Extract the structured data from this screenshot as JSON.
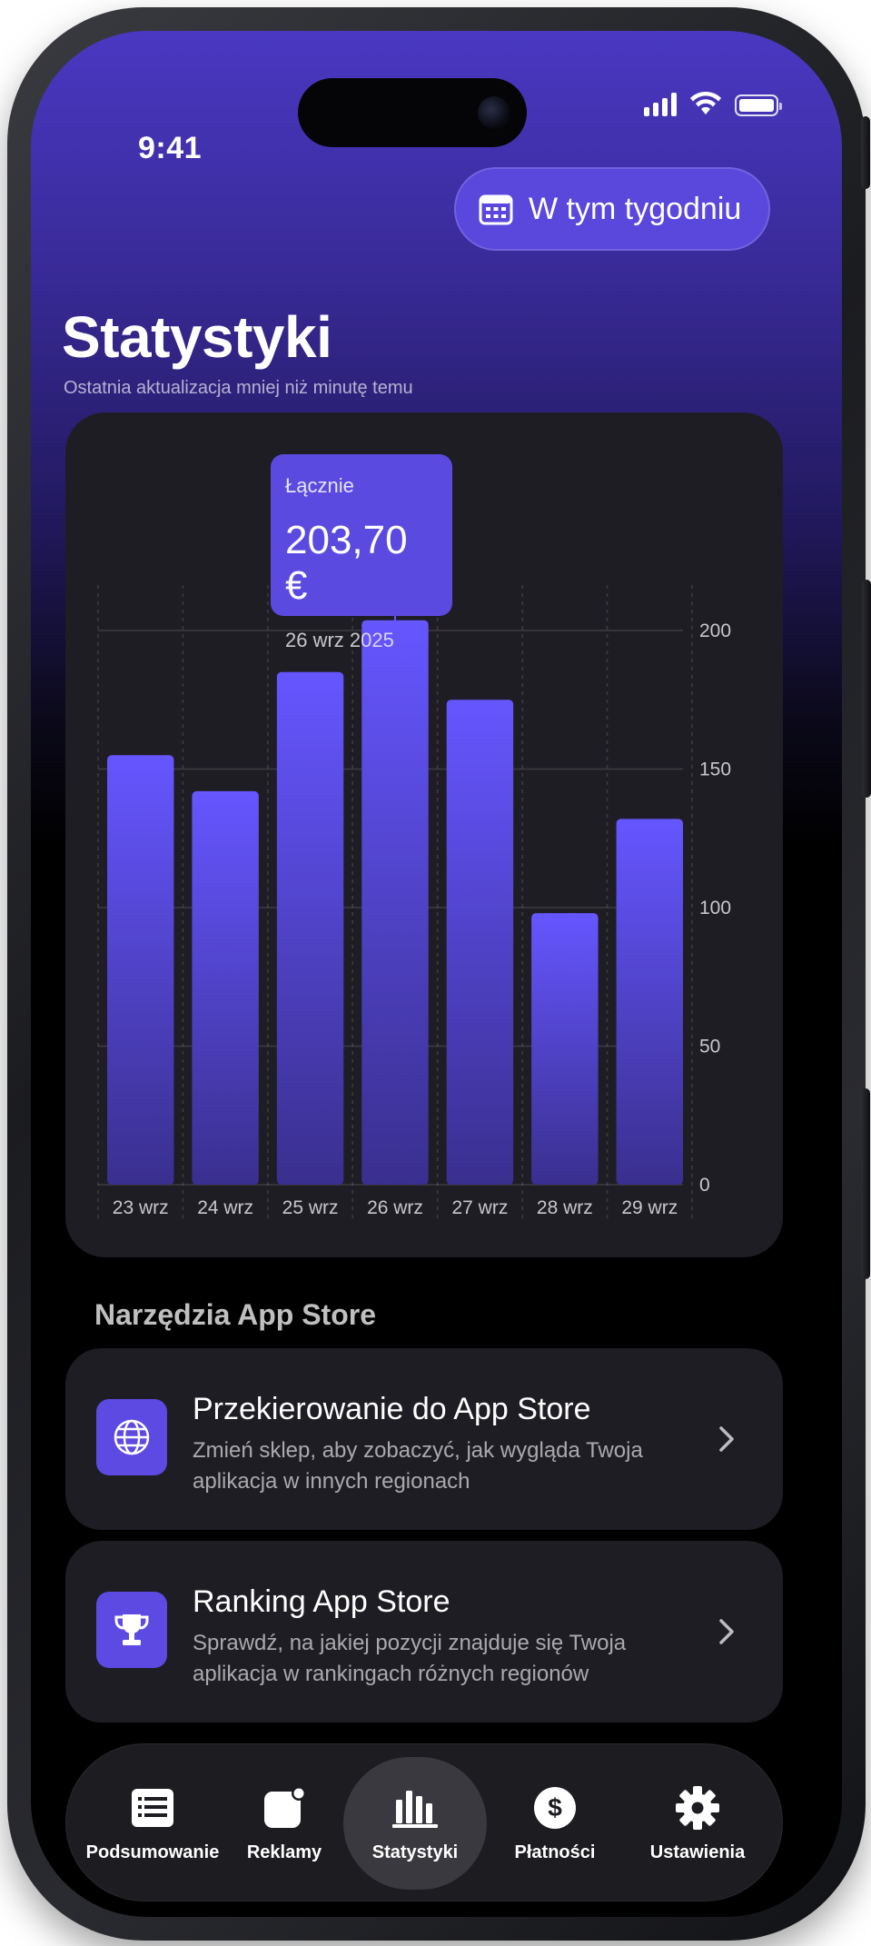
{
  "status_bar": {
    "time": "9:41"
  },
  "header": {
    "period_button_label": "W tym tygodniu",
    "title": "Statystyki",
    "subtitle": "Ostatnia aktualizacja mniej niż minutę temu"
  },
  "tooltip": {
    "label": "Łącznie",
    "value": "203,70 €",
    "date": "26 wrz 2025"
  },
  "chart_data": {
    "type": "bar",
    "categories": [
      "23 wrz",
      "24 wrz",
      "25 wrz",
      "26 wrz",
      "27 wrz",
      "28 wrz",
      "29 wrz"
    ],
    "values": [
      155,
      142,
      185,
      203.7,
      175,
      98,
      132
    ],
    "ylim": [
      0,
      200
    ],
    "yticks": [
      0,
      50,
      100,
      150,
      200
    ],
    "highlight_index": 3,
    "grid": true,
    "axis_position": "right",
    "bar_color": "#6556ff"
  },
  "tools_section": {
    "title": "Narzędzia App Store",
    "items": [
      {
        "title": "Przekierowanie do App Store",
        "description": "Zmień sklep, aby zobaczyć, jak wygląda Twoja aplikacja w innych regionach",
        "icon": "globe-icon"
      },
      {
        "title": "Ranking App Store",
        "description": "Sprawdź, na jakiej pozycji znajduje się Twoja aplikacja w rankingach różnych regionów",
        "icon": "trophy-icon"
      }
    ]
  },
  "tab_bar": {
    "tabs": [
      {
        "label": "Podsumowanie",
        "icon": "summary-icon"
      },
      {
        "label": "Reklamy",
        "icon": "ads-icon"
      },
      {
        "label": "Statystyki",
        "icon": "stats-icon",
        "active": true
      },
      {
        "label": "Płatności",
        "icon": "dollar-icon"
      },
      {
        "label": "Ustawienia",
        "icon": "gear-icon"
      }
    ]
  },
  "colors": {
    "accent": "#5b4ae0",
    "background_top": "#4a38c2",
    "card": "#1f1d24"
  }
}
